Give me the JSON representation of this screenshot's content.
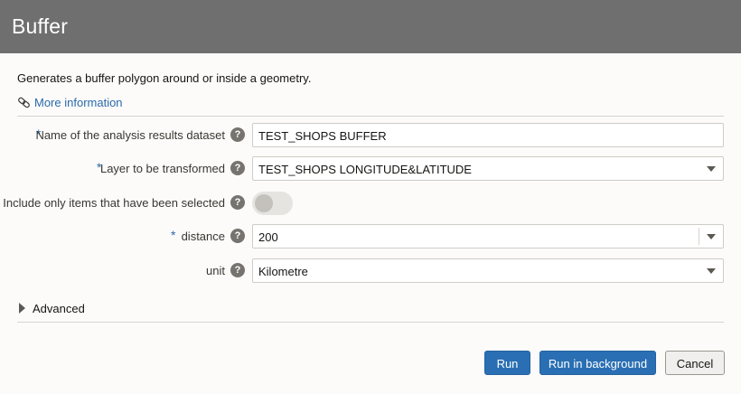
{
  "dialog": {
    "title": "Buffer",
    "description": "Generates a buffer polygon around or inside a geometry.",
    "more_info": "More information",
    "advanced": "Advanced"
  },
  "fields": {
    "dataset_name": {
      "label": "Name of the analysis results dataset",
      "required_mark": "*",
      "value": "TEST_SHOPS BUFFER",
      "help": "?"
    },
    "layer": {
      "label": "Layer to be transformed",
      "required_mark": "*",
      "value": "TEST_SHOPS LONGITUDE&LATITUDE",
      "help": "?"
    },
    "selected_only": {
      "label": "Include only items that have been selected",
      "help": "?",
      "checked": false
    },
    "distance": {
      "label": "distance",
      "required_mark": "*",
      "value": "200",
      "help": "?"
    },
    "unit": {
      "label": "unit",
      "value": "Kilometre",
      "help": "?"
    }
  },
  "buttons": {
    "run": "Run",
    "run_background": "Run in background",
    "cancel": "Cancel"
  },
  "icons": {
    "more_info": "link-icon",
    "help": "help-icon",
    "dropdown": "chevron-down-icon",
    "advanced": "disclosure-triangle-icon"
  },
  "colors": {
    "header_bg": "#6f6f6f",
    "link": "#2a6aa8",
    "primary_button": "#2a6fb3",
    "required_mark": "#2a6aa8"
  }
}
